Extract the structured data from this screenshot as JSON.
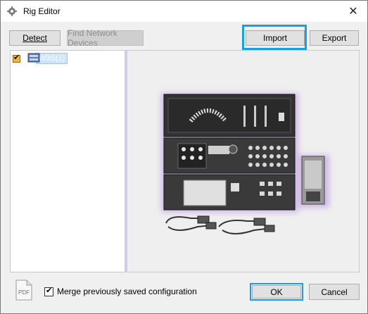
{
  "window": {
    "title": "Rig Editor",
    "icons": {
      "app": "gear-icon",
      "close": "close-icon"
    }
  },
  "toolbar": {
    "detect_label": "Detect",
    "find_devices_label": "Find Network Devices",
    "import_label": "Import",
    "export_label": "Export"
  },
  "tree": {
    "items": [
      {
        "label": "W3S(1)",
        "checked": true
      }
    ]
  },
  "preview": {
    "image": "device-rig-illustration"
  },
  "footer": {
    "pdf_label": "PDF",
    "merge_label": "Merge previously saved configuration",
    "merge_checked": true,
    "ok_label": "OK",
    "cancel_label": "Cancel"
  },
  "colors": {
    "accent": "#1a9ee0",
    "selection": "#cde5fb"
  }
}
